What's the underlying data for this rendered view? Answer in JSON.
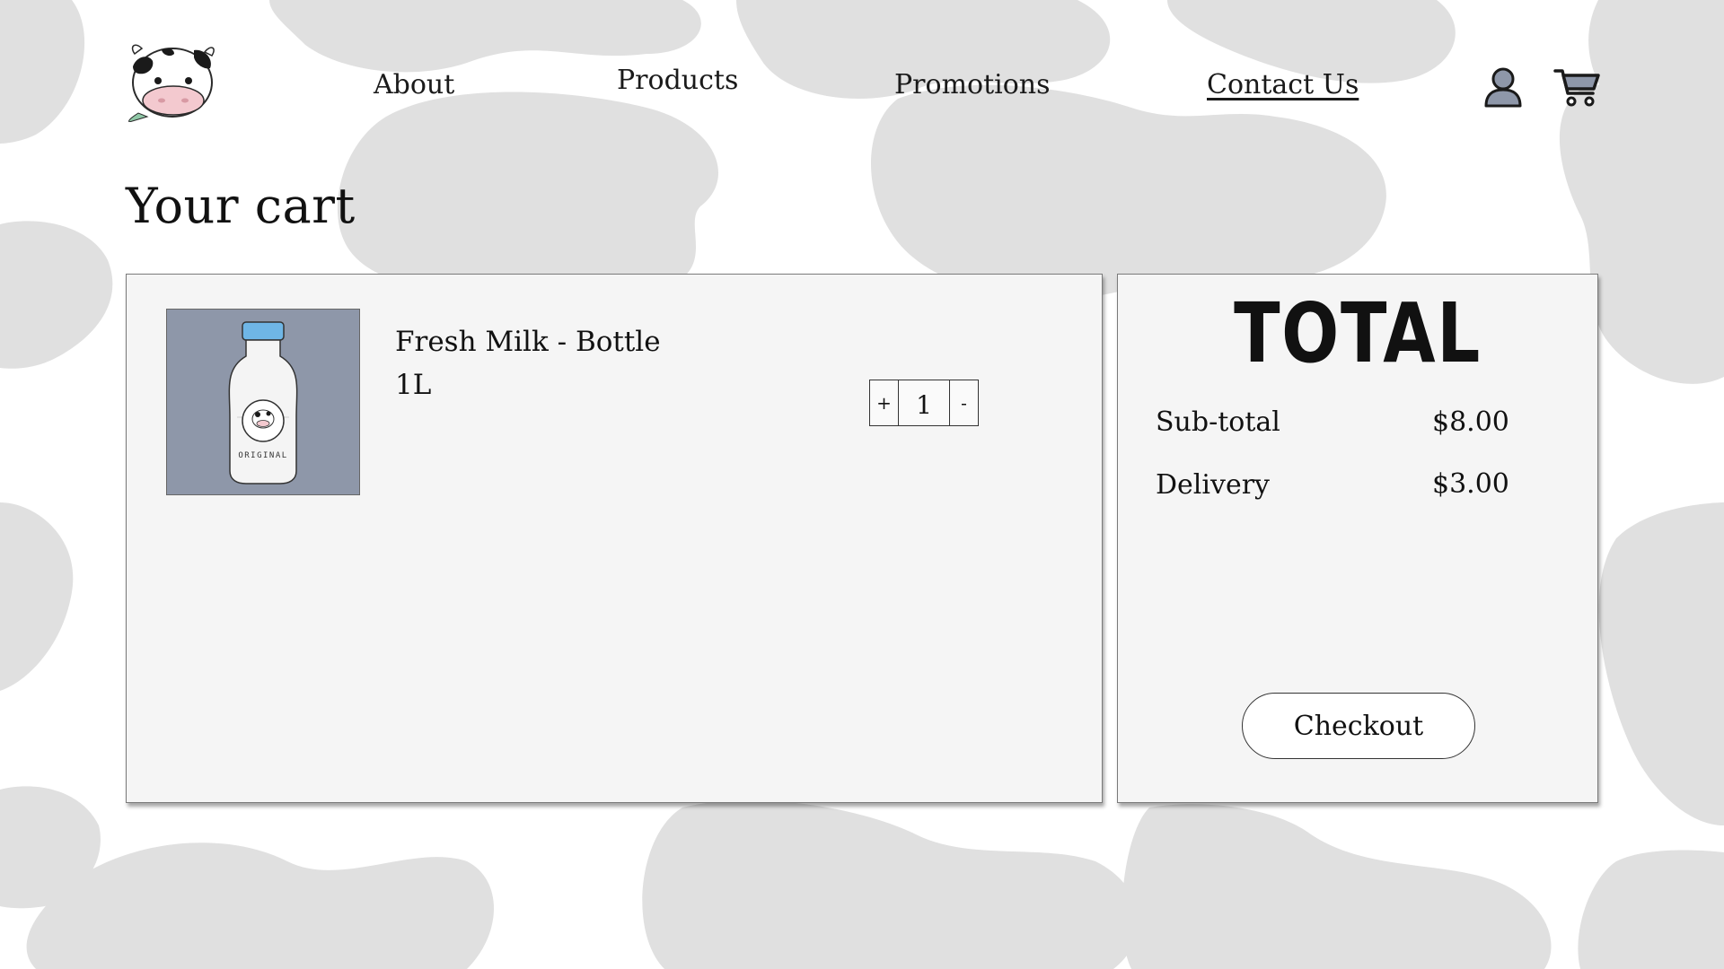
{
  "header": {
    "logo_icon": "cow-head-logo-icon",
    "nav": {
      "about": "About",
      "products": "Products",
      "promotions": "Promotions",
      "contact": "Contact Us"
    },
    "active_nav": "contact",
    "account_icon": "user-account-icon",
    "cart_icon": "shopping-cart-icon"
  },
  "page": {
    "title": "Your cart"
  },
  "cart": {
    "items": [
      {
        "name": "Fresh Milk - Bottle",
        "size": "1L",
        "quantity": "1",
        "image_icon": "milk-bottle-image",
        "bottle_label": "ORIGINAL",
        "plus_label": "+",
        "minus_label": "-"
      }
    ]
  },
  "summary": {
    "title": "TOTAL",
    "subtotal_label": "Sub-total",
    "subtotal_value": "$8.00",
    "delivery_label": "Delivery",
    "delivery_value": "$3.00",
    "checkout_label": "Checkout"
  },
  "colors": {
    "background": "#ffffff",
    "cow_spots": "#e0e0e0",
    "panel": "#f5f5f5",
    "product_image_bg": "#8e97a9",
    "bottle_cap": "#6fb6e6",
    "icon_fill": "#8e97a9"
  }
}
